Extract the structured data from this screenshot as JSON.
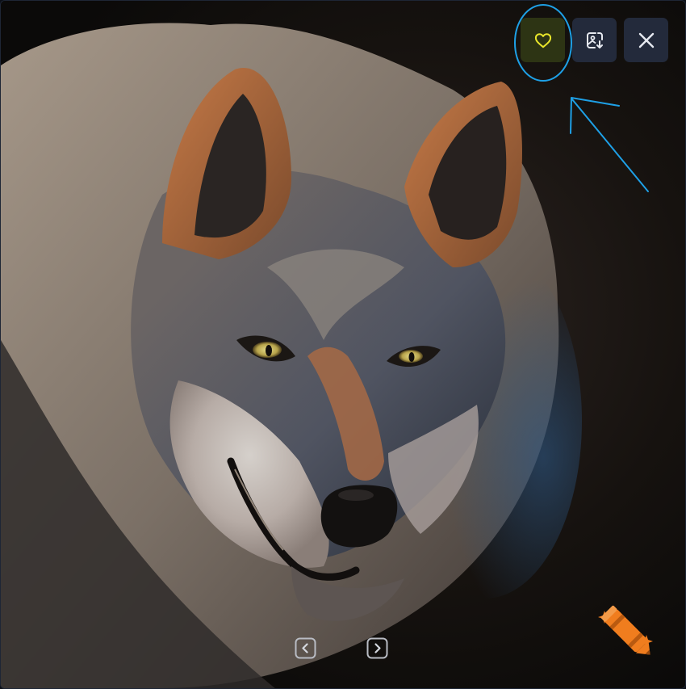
{
  "viewer": {
    "image": {
      "subject": "wolf-portrait"
    },
    "toolbar": {
      "buttons": [
        {
          "name": "favorite",
          "icon": "heart-icon",
          "active": true,
          "icon_color": "#e9e62a"
        },
        {
          "name": "download-image",
          "icon": "image-download-icon",
          "active": false,
          "icon_color": "#e6e9f0"
        },
        {
          "name": "close",
          "icon": "close-icon",
          "active": false,
          "icon_color": "#e6e9f0"
        }
      ]
    },
    "pager": {
      "prev_icon": "chevron-left-icon",
      "next_icon": "chevron-right-icon"
    },
    "brand": {
      "icon": "crayon-sparkle-icon",
      "color": "#f07d1e"
    }
  },
  "annotation": {
    "shapes": [
      "ellipse-highlight",
      "pointer-arrow"
    ],
    "color": "#1ea0e6"
  },
  "colors": {
    "toolbar_button_bg": "#232a3b",
    "favorite_active_bg": "#2d3414",
    "frame_border": "#1e2635"
  }
}
